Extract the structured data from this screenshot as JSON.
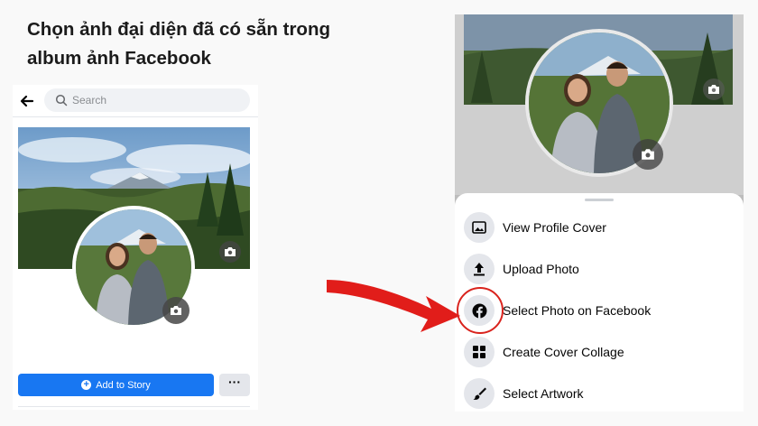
{
  "headline": "Chọn ảnh đại diện đã có sẵn trong album ảnh Facebook",
  "left": {
    "search_placeholder": "Search",
    "add_to_story": "Add to Story",
    "more": "···",
    "icons": [
      "back-arrow-icon",
      "search-icon",
      "camera-icon",
      "plus-icon"
    ]
  },
  "right": {
    "sheet_items": [
      {
        "label": "View Profile Cover",
        "icon": "photo-icon"
      },
      {
        "label": "Upload Photo",
        "icon": "upload-icon"
      },
      {
        "label": "Select Photo on Facebook",
        "icon": "facebook-icon"
      },
      {
        "label": "Create Cover Collage",
        "icon": "grid-icon"
      },
      {
        "label": "Select Artwork",
        "icon": "brush-icon"
      }
    ]
  },
  "colors": {
    "accent": "#1877f2",
    "annotation": "#d9231d"
  }
}
